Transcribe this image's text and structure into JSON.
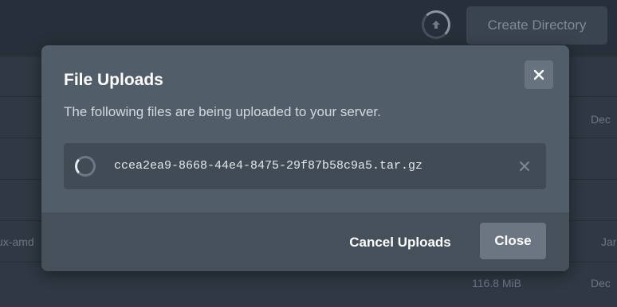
{
  "header": {
    "create_directory_label": "Create Directory",
    "upload_icon": "upload-arrow-icon"
  },
  "file_list": {
    "rows": [
      {
        "date": "Dec"
      },
      {
        "date": ""
      },
      {
        "date": ""
      },
      {
        "name_fragment": "ux-amd",
        "date": "Jar"
      },
      {
        "size": "116.8 MiB",
        "date": "Dec"
      }
    ]
  },
  "modal": {
    "title": "File Uploads",
    "subtitle": "The following files are being uploaded to your server.",
    "close_icon": "close-icon",
    "uploads": [
      {
        "file_name": "ccea2ea9-8668-44e4-8475-29f87b58c9a5.tar.gz",
        "status_icon": "loading-spinner-icon",
        "remove_icon": "remove-icon"
      }
    ],
    "cancel_label": "Cancel Uploads",
    "close_label": "Close"
  },
  "colors": {
    "page_bg": "#2b333d",
    "modal_bg": "#515d69",
    "modal_footer_bg": "#45505b",
    "upload_item_bg": "#404b56",
    "close_button_bg": "#6b7682",
    "text_primary": "#ffffff"
  }
}
